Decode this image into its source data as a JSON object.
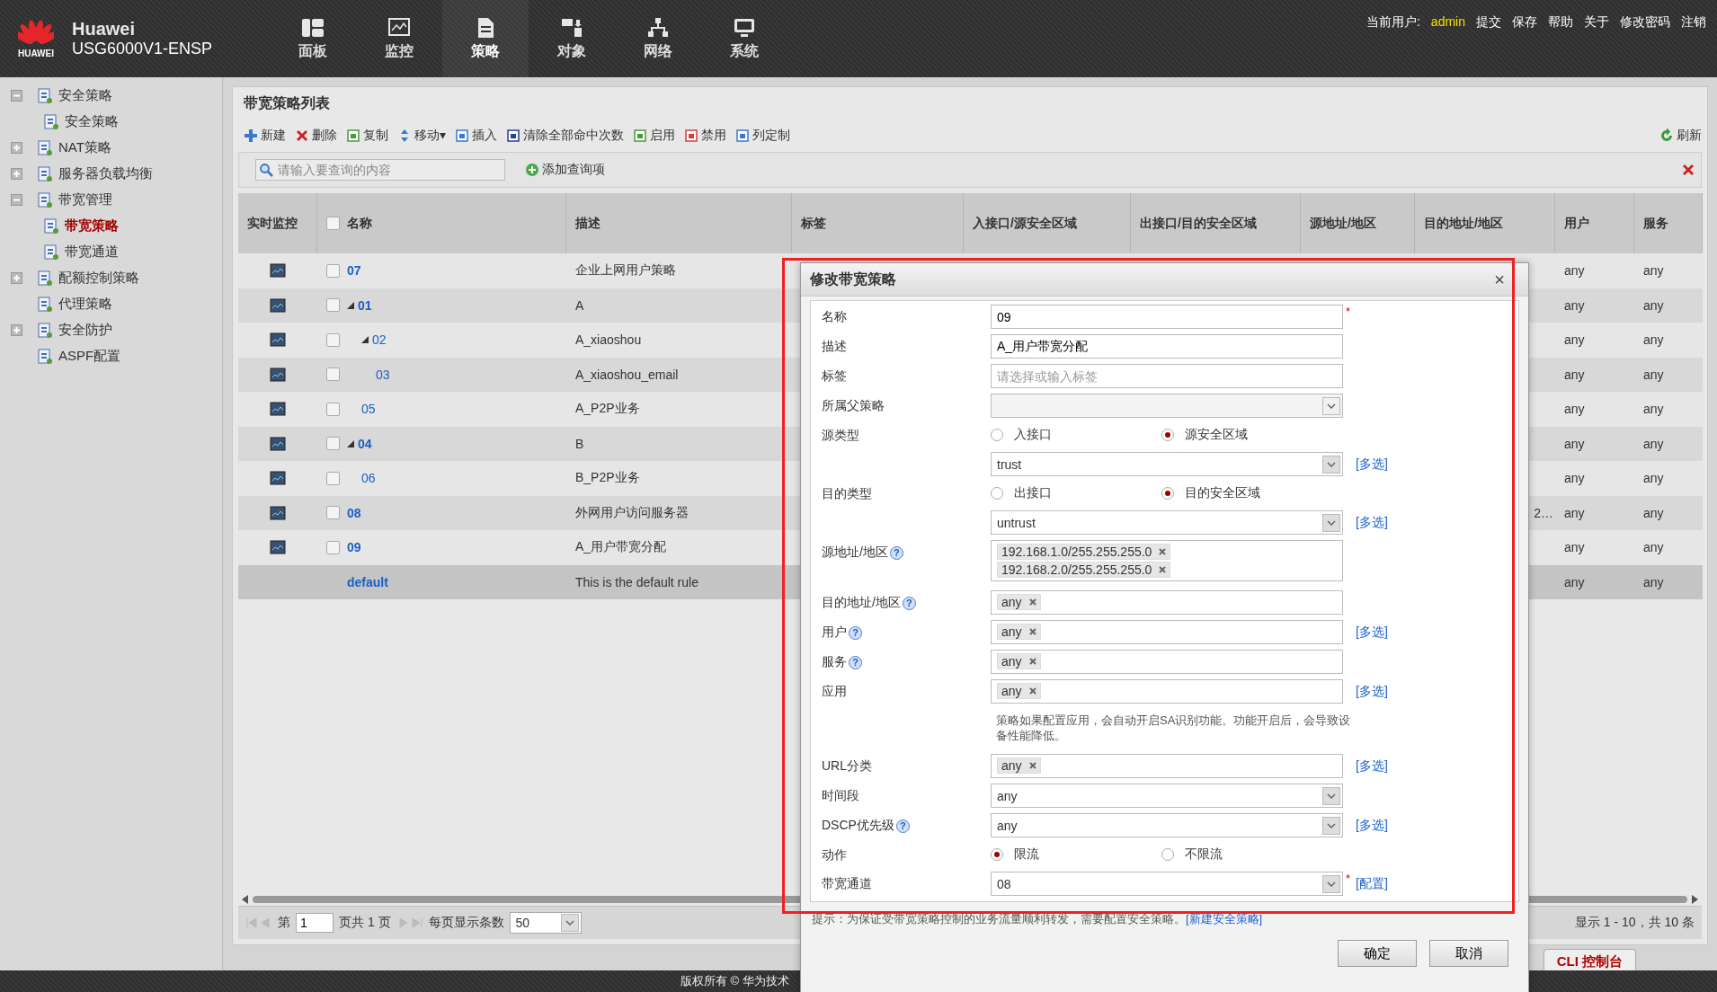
{
  "header": {
    "brand": "Huawei",
    "model": "USG6000V1-ENSP",
    "logo_text": "HUAWEI",
    "nav": [
      {
        "label": "面板",
        "selected": false
      },
      {
        "label": "监控",
        "selected": false
      },
      {
        "label": "策略",
        "selected": true
      },
      {
        "label": "对象",
        "selected": false
      },
      {
        "label": "网络",
        "selected": false
      },
      {
        "label": "系统",
        "selected": false
      }
    ],
    "user_label": "当前用户:",
    "user": "admin",
    "links": [
      "提交",
      "保存",
      "帮助",
      "关于",
      "修改密码",
      "注销"
    ]
  },
  "sidebar": {
    "items": [
      {
        "label": "安全策略",
        "kind": "folder",
        "expanded": true,
        "selected": false,
        "children": [
          {
            "label": "安全策略",
            "selected": false
          }
        ]
      },
      {
        "label": "NAT策略",
        "kind": "folder",
        "expanded": false,
        "selected": false
      },
      {
        "label": "服务器负载均衡",
        "kind": "folder",
        "expanded": false,
        "selected": false
      },
      {
        "label": "带宽管理",
        "kind": "folder",
        "expanded": true,
        "selected": false,
        "children": [
          {
            "label": "带宽策略",
            "selected": true
          },
          {
            "label": "带宽通道",
            "selected": false
          }
        ]
      },
      {
        "label": "配额控制策略",
        "kind": "folder",
        "expanded": false,
        "selected": false
      },
      {
        "label": "代理策略",
        "kind": "leaf",
        "selected": false
      },
      {
        "label": "安全防护",
        "kind": "folder",
        "expanded": false,
        "selected": false
      },
      {
        "label": "ASPF配置",
        "kind": "leaf",
        "selected": false
      }
    ]
  },
  "panel": {
    "title": "带宽策略列表",
    "toolbar": [
      "新建",
      "删除",
      "复制",
      "移动▾",
      "插入",
      "清除全部命中次数",
      "启用",
      "禁用",
      "列定制"
    ],
    "refresh": "刷新",
    "search": {
      "placeholder": "请输入要查询的内容"
    },
    "add_query": "添加查询项"
  },
  "table": {
    "columns": [
      "实时监控",
      "名称",
      "描述",
      "标签",
      "入接口/源安全区域",
      "出接口/目的安全区域",
      "源地址/地区",
      "目的地址/地区",
      "用户",
      "服务"
    ],
    "all_checked": false,
    "rows": [
      {
        "kind": "policy",
        "name": "07",
        "checked": false,
        "description": "企业上网用户策略",
        "user": "any",
        "service": "any"
      },
      {
        "kind": "policy",
        "name": "01",
        "checked": false,
        "description": "A",
        "user": "any",
        "service": "any",
        "expanded": true,
        "children": [
          {
            "kind": "policy",
            "name": "02",
            "checked": false,
            "description": "A_xiaoshou",
            "user": "any",
            "service": "any",
            "expanded": true,
            "children": [
              {
                "kind": "policy",
                "name": "03",
                "checked": false,
                "description": "A_xiaoshou_email",
                "user": "any",
                "service": "any"
              }
            ]
          },
          {
            "kind": "policy",
            "name": "05",
            "checked": false,
            "description": "A_P2P业务",
            "user": "any",
            "service": "any"
          }
        ]
      },
      {
        "kind": "policy",
        "name": "04",
        "checked": false,
        "description": "B",
        "user": "any",
        "service": "any",
        "expanded": true,
        "children": [
          {
            "kind": "policy",
            "name": "06",
            "checked": false,
            "description": "B_P2P业务",
            "user": "any",
            "service": "any"
          }
        ]
      },
      {
        "kind": "policy",
        "name": "08",
        "checked": false,
        "description": "外网用户访问服务器",
        "destination": "2…",
        "user": "any",
        "service": "any"
      },
      {
        "kind": "policy",
        "name": "09",
        "checked": false,
        "description": "A_用户带宽分配",
        "user": "any",
        "service": "any"
      },
      {
        "kind": "default",
        "name": "default",
        "description": "This is the default rule",
        "user": "any",
        "service": "any"
      }
    ]
  },
  "pager": {
    "page_prefix": "第",
    "page": "1",
    "page_suffix": "页共 1 页",
    "per_page_label": "每页显示条数",
    "per_page": "50",
    "summary": "显示 1 - 10，共 10 条"
  },
  "cli_tab": "CLI 控制台",
  "footer": "版权所有 © 华为技术",
  "dialog": {
    "title": "修改带宽策略",
    "close": "×",
    "fields": [
      {
        "kind": "text",
        "label": "名称",
        "value": "09",
        "required_mark": "*"
      },
      {
        "kind": "text",
        "label": "描述",
        "value": "A_用户带宽分配"
      },
      {
        "kind": "text",
        "label": "标签",
        "placeholder": "请选择或输入标签"
      },
      {
        "kind": "select",
        "label": "所属父策略",
        "disabled": true
      },
      {
        "kind": "radio",
        "label": "源类型",
        "options": [
          {
            "label": "入接口",
            "selected": false
          },
          {
            "label": "源安全区域",
            "selected": true
          }
        ]
      },
      {
        "kind": "select",
        "value": "trust",
        "disabled": false,
        "link": "[多选]"
      },
      {
        "kind": "radio",
        "label": "目的类型",
        "options": [
          {
            "label": "出接口",
            "selected": false
          },
          {
            "label": "目的安全区域",
            "selected": true
          }
        ]
      },
      {
        "kind": "select",
        "value": "untrust",
        "disabled": false,
        "link": "[多选]"
      },
      {
        "kind": "tags",
        "label": "源地址/地区",
        "help": "?",
        "tags": [
          "192.168.1.0/255.255.255.0",
          "192.168.2.0/255.255.255.0"
        ]
      },
      {
        "kind": "tags",
        "label": "目的地址/地区",
        "help": "?",
        "tags": [
          "any"
        ]
      },
      {
        "kind": "tags",
        "label": "用户",
        "help": "?",
        "tags": [
          "any"
        ],
        "link": "[多选]"
      },
      {
        "kind": "tags",
        "label": "服务",
        "help": "?",
        "tags": [
          "any"
        ]
      },
      {
        "kind": "tags",
        "label": "应用",
        "tags": [
          "any"
        ],
        "link": "[多选]"
      },
      {
        "kind": "note",
        "text": "策略如果配置应用，会自动开启SA识别功能。功能开启后，会导致设备性能降低。"
      },
      {
        "kind": "tags",
        "label": "URL分类",
        "tags": [
          "any"
        ],
        "link": "[多选]"
      },
      {
        "kind": "select",
        "label": "时间段",
        "value": "any",
        "disabled": false
      },
      {
        "kind": "select",
        "label": "DSCP优先级",
        "help": "?",
        "value": "any",
        "disabled": false,
        "link": "[多选]"
      },
      {
        "kind": "radio",
        "label": "动作",
        "options": [
          {
            "label": "限流",
            "selected": true
          },
          {
            "label": "不限流",
            "selected": false
          }
        ]
      },
      {
        "kind": "select",
        "label": "带宽通道",
        "value": "08",
        "disabled": false,
        "required_mark": "*",
        "link": "[配置]"
      }
    ],
    "hint": "提示：为保证受带宽策略控制的业务流量顺利转发，需要配置安全策略。",
    "hint_link": "[新建安全策略]",
    "buttons": [
      "确定",
      "取消"
    ]
  }
}
